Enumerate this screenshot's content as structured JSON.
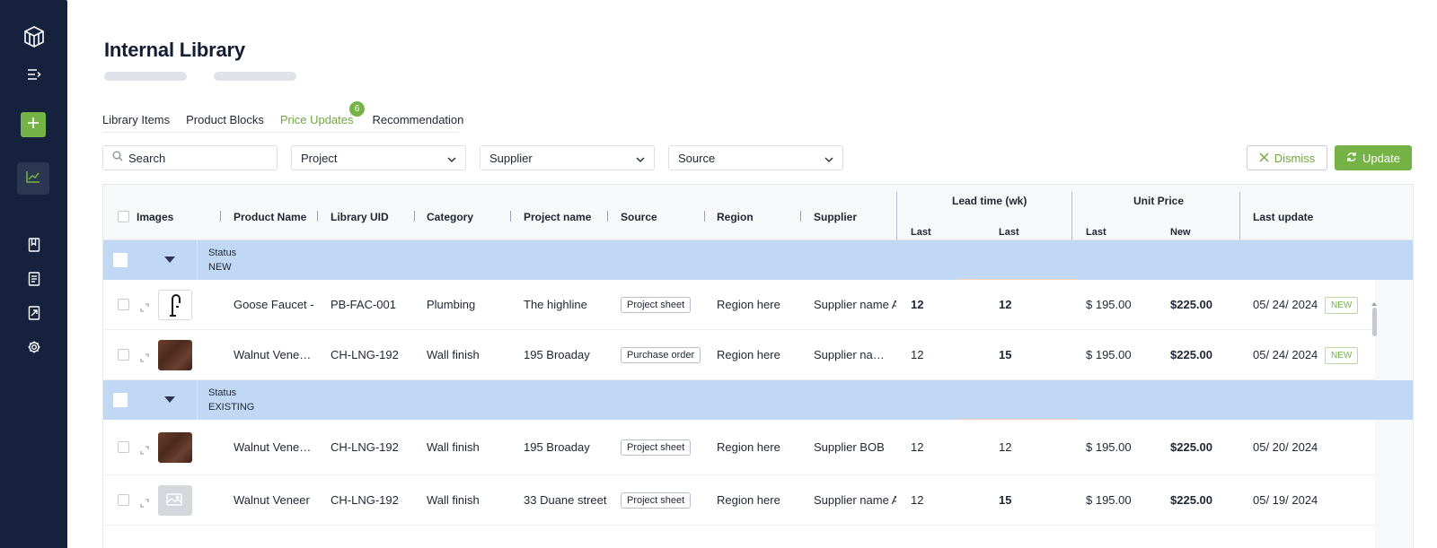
{
  "page": {
    "title": "Internal Library"
  },
  "tabs": [
    {
      "label": "Library Items"
    },
    {
      "label": "Product Blocks"
    },
    {
      "label": "Price Updates",
      "badge": "6",
      "active": true
    },
    {
      "label": "Recommendation"
    }
  ],
  "filters": {
    "search_placeholder": "Search",
    "project": "Project",
    "supplier": "Supplier",
    "source": "Source"
  },
  "actions": {
    "dismiss": "Dismiss",
    "update": "Update"
  },
  "table": {
    "headers": {
      "images": "Images",
      "product_name": "Product Name",
      "library_uid": "Library UID",
      "category": "Category",
      "project_name": "Project name",
      "source": "Source",
      "region": "Region",
      "supplier": "Supplier",
      "lead_time": "Lead time (wk)",
      "lead_last": "Last",
      "lead_last2": "Last",
      "unit_price": "Unit Price",
      "price_last": "Last",
      "price_new": "New",
      "last_update": "Last update"
    },
    "groups": [
      {
        "label": "Status",
        "value": "NEW",
        "rows": [
          {
            "image": "faucet",
            "product_name": "Goose Faucet - M",
            "uid": "PB-FAC-001",
            "category": "Plumbing",
            "project": "The highline",
            "source": "Project sheet",
            "region": "Region here",
            "supplier": "Supplier name A",
            "lead_last": "12",
            "lead_new": "12",
            "price_last": "$ 195.00",
            "price_new": "$225.00",
            "date": "05/ 24/ 2024",
            "badge": "NEW"
          },
          {
            "image": "walnut",
            "product_name": "Walnut Vene…",
            "uid": "CH-LNG-192",
            "category": "Wall finish",
            "project": "195 Broaday",
            "source": "Purchase order",
            "region": "Region here",
            "supplier": "Supplier na…",
            "lead_last": "12",
            "lead_new": "15",
            "price_last": "$ 195.00",
            "price_new": "$225.00",
            "date": "05/ 24/ 2024",
            "badge": "NEW"
          }
        ]
      },
      {
        "label": "Status",
        "value": "EXISTING",
        "rows": [
          {
            "image": "walnut",
            "product_name": "Walnut Vene…",
            "uid": "CH-LNG-192",
            "category": "Wall finish",
            "project": "195 Broaday",
            "source": "Project sheet",
            "region": "Region here",
            "supplier": "Supplier BOB",
            "lead_last": "12",
            "lead_new": "12",
            "price_last": "$ 195.00",
            "price_new": "$225.00",
            "date": "05/ 20/ 2024"
          },
          {
            "image": "placeholder",
            "product_name": "Walnut Veneer",
            "uid": "CH-LNG-192",
            "category": "Wall finish",
            "project": "33 Duane street",
            "source": "Project sheet",
            "region": "Region here",
            "supplier": "Supplier name A",
            "lead_last": "12",
            "lead_new": "15",
            "price_last": "$ 195.00",
            "price_new": "$225.00",
            "date": "05/ 19/ 2024"
          }
        ]
      }
    ]
  },
  "colors": {
    "sidebar": "#16213d",
    "accent": "#76b347",
    "group_row": "#c0d8f3"
  },
  "icons": [
    "logo-icon",
    "menu-collapse-icon",
    "plus-icon",
    "chart-icon",
    "book-icon",
    "document-icon",
    "export-icon",
    "gear-icon",
    "search-icon",
    "chevron-down-icon",
    "close-icon",
    "refresh-icon",
    "caret-down-icon",
    "expand-icon",
    "image-icon"
  ]
}
